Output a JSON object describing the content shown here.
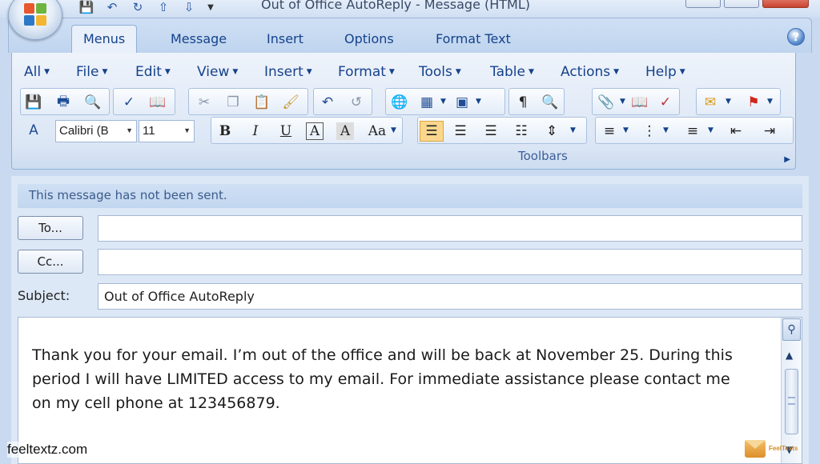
{
  "window": {
    "title": "Out of Office AutoReply - Message (HTML)"
  },
  "quick_access": [
    "save-icon",
    "undo-icon",
    "redo-icon",
    "up-arrow-icon",
    "down-arrow-icon",
    "customize-icon"
  ],
  "ribbon": {
    "tabs": [
      {
        "label": "Menus",
        "active": true
      },
      {
        "label": "Message",
        "active": false
      },
      {
        "label": "Insert",
        "active": false
      },
      {
        "label": "Options",
        "active": false
      },
      {
        "label": "Format Text",
        "active": false
      }
    ],
    "menus": [
      "All",
      "File",
      "Edit",
      "View",
      "Insert",
      "Format",
      "Tools",
      "Table",
      "Actions",
      "Help"
    ],
    "font_name": "Calibri (B",
    "font_size": "11",
    "group_label": "Toolbars"
  },
  "compose": {
    "info_bar": "This message has not been sent.",
    "to_button": "To...",
    "cc_button": "Cc...",
    "to_value": "",
    "cc_value": "",
    "subject_label": "Subject:",
    "subject_value": "Out of Office AutoReply",
    "body_lines": [
      "Thank you for your email.  I’m out of the office and will be back at November 25.  During this",
      "period I will have LIMITED access to my email. For immediate assistance please contact me",
      "on my cell phone at 123456879."
    ]
  },
  "watermarks": {
    "left": "feeltextz.com",
    "right": "FeelTexts"
  },
  "colors": {
    "ribbon_text": "#15428b",
    "ribbon_bg": "#dbe6f5",
    "frame_bg": "#c9daf0",
    "field_border": "#a6b8d2"
  }
}
